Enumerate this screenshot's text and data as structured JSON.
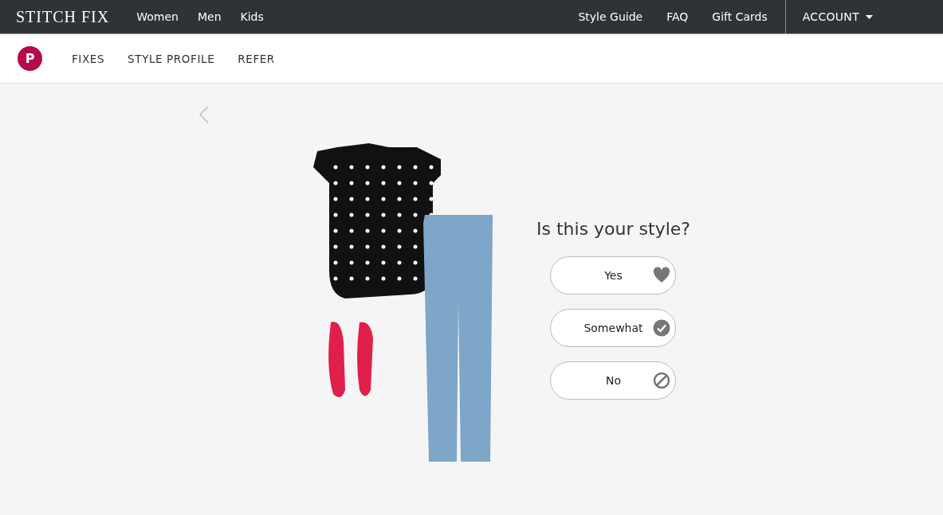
{
  "top_nav": {
    "logo": "STITCH FIX",
    "left_links": [
      "Women",
      "Men",
      "Kids"
    ],
    "right_links": [
      "Style Guide",
      "FAQ",
      "Gift Cards"
    ],
    "account": "ACCOUNT"
  },
  "sub_nav": {
    "avatar_letter": "P",
    "items": [
      "FIXES",
      "STYLE PROFILE",
      "REFER"
    ]
  },
  "question": "Is this your style?",
  "answers": [
    {
      "label": "Yes",
      "kind": "heart"
    },
    {
      "label": "Somewhat",
      "kind": "check"
    },
    {
      "label": "No",
      "kind": "ban"
    }
  ]
}
